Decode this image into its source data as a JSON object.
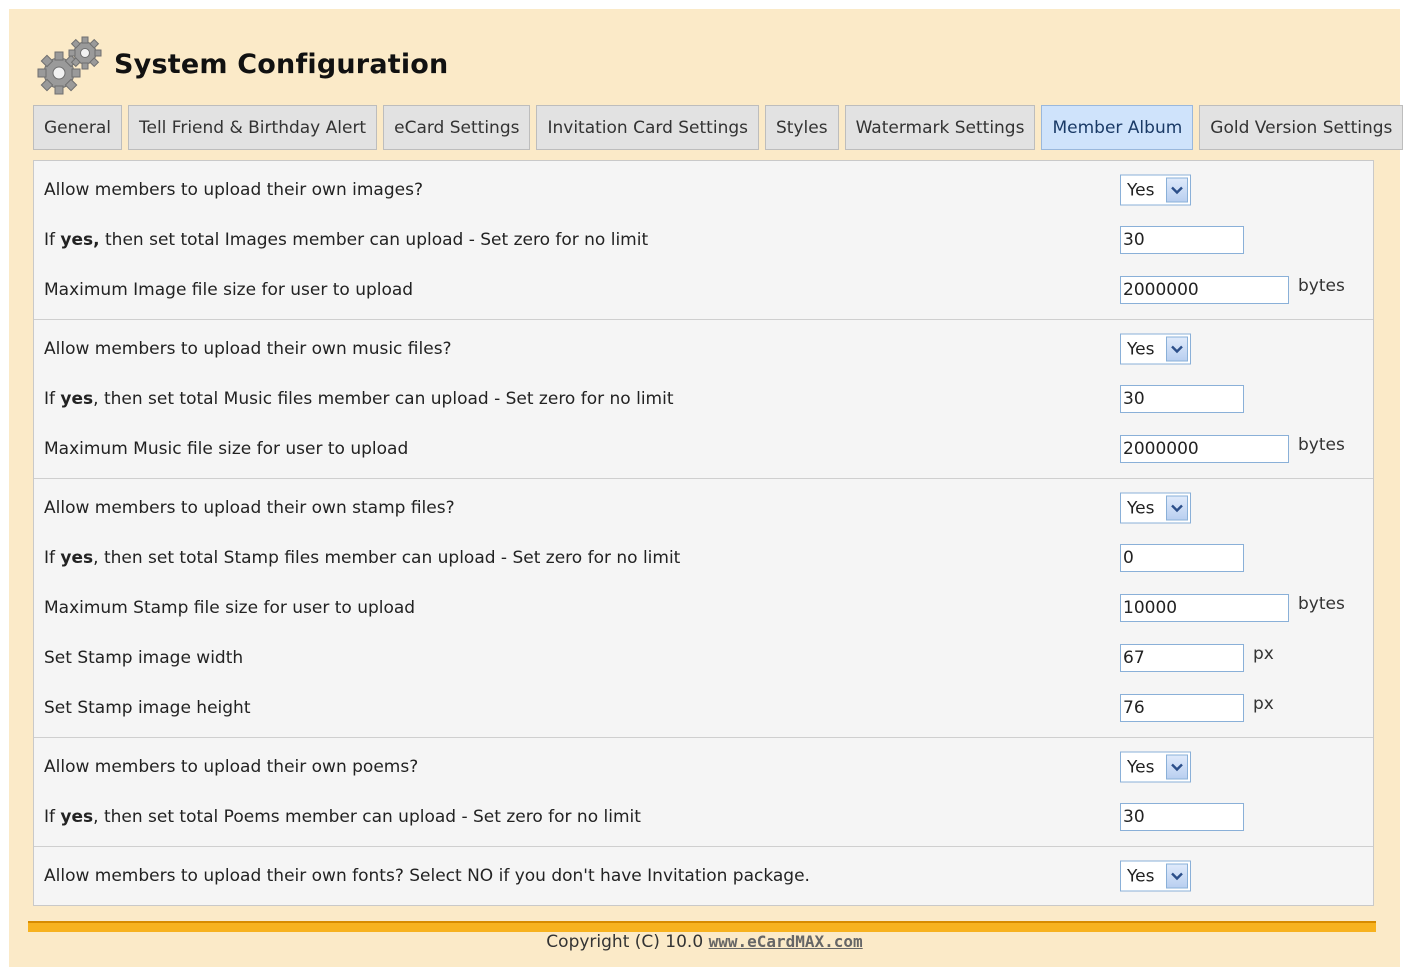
{
  "app": {
    "title": "System Configuration",
    "icon": "gears-icon"
  },
  "tabs": [
    {
      "label": "General",
      "active": false
    },
    {
      "label": "Tell Friend & Birthday Alert",
      "active": false
    },
    {
      "label": "eCard Settings",
      "active": false
    },
    {
      "label": "Invitation Card Settings",
      "active": false
    },
    {
      "label": "Styles",
      "active": false
    },
    {
      "label": "Watermark Settings",
      "active": false
    },
    {
      "label": "Member Album",
      "active": true
    },
    {
      "label": "Gold Version Settings",
      "active": false
    }
  ],
  "groups": [
    {
      "name": "images",
      "rows": [
        {
          "type": "select",
          "label": "Allow members to upload their own images?",
          "value": "Yes"
        },
        {
          "type": "input",
          "label_pre": "If ",
          "label_bold": "yes,",
          "label_post": " then set total Images member can upload - Set zero for no limit",
          "value": "30",
          "size": "short"
        },
        {
          "type": "input",
          "label": "Maximum Image file size for user to upload",
          "value": "2000000",
          "size": "long",
          "unit": "bytes"
        }
      ]
    },
    {
      "name": "music",
      "rows": [
        {
          "type": "select",
          "label": "Allow members to upload their own music files?",
          "value": "Yes"
        },
        {
          "type": "input",
          "label_pre": "If ",
          "label_bold": "yes",
          "label_post": ", then set total Music files member can upload - Set zero for no limit",
          "value": "30",
          "size": "short"
        },
        {
          "type": "input",
          "label": "Maximum Music file size for user to upload",
          "value": "2000000",
          "size": "long",
          "unit": "bytes"
        }
      ]
    },
    {
      "name": "stamp",
      "rows": [
        {
          "type": "select",
          "label": "Allow members to upload their own stamp files?",
          "value": "Yes"
        },
        {
          "type": "input",
          "label_pre": "If ",
          "label_bold": "yes",
          "label_post": ", then set total Stamp files member can upload - Set zero for no limit",
          "value": "0",
          "size": "short"
        },
        {
          "type": "input",
          "label": "Maximum Stamp file size for user to upload",
          "value": "10000",
          "size": "long",
          "unit": "bytes"
        },
        {
          "type": "input",
          "label": "Set Stamp image width",
          "value": "67",
          "size": "short",
          "unit": "px"
        },
        {
          "type": "input",
          "label": "Set Stamp image height",
          "value": "76",
          "size": "short",
          "unit": "px"
        }
      ]
    },
    {
      "name": "poems",
      "rows": [
        {
          "type": "select",
          "label": "Allow members to upload their own poems?",
          "value": "Yes"
        },
        {
          "type": "input",
          "label_pre": "If ",
          "label_bold": "yes",
          "label_post": ", then set total Poems member can upload - Set zero for no limit",
          "value": "30",
          "size": "short"
        }
      ]
    },
    {
      "name": "fonts",
      "rows": [
        {
          "type": "select",
          "label": "Allow members to upload their own fonts? Select NO if you don't have Invitation package.",
          "value": "Yes"
        }
      ]
    }
  ],
  "footer": {
    "copyright": "Copyright (C) 10.0 ",
    "link_text": "www.eCardMAX.com"
  },
  "colors": {
    "background": "#fbeac8",
    "active_tab": "#cfe3fb",
    "footer_bar": "#f7b21f"
  }
}
